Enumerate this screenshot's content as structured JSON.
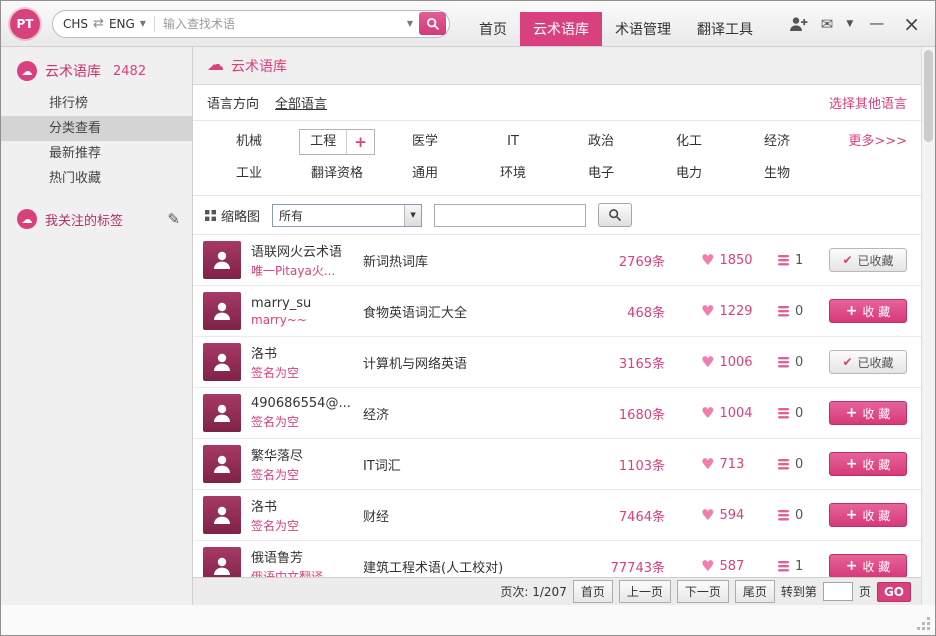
{
  "colors": {
    "accent": "#d8417d",
    "accent_dark": "#c02f67",
    "active_tab_bg": "#d8417d",
    "avatar_bg": "#8e2a55",
    "heart": "#f07fae",
    "sidebar_bg": "#f0f0f0"
  },
  "icons": {
    "swap": "⇄",
    "caret_down": "▼",
    "cloud": "☁",
    "pencil": "✎",
    "mail": "✉",
    "heart": "♥",
    "check": "✔",
    "plus": "+",
    "minimize": "—",
    "close": "×"
  },
  "topbar": {
    "logo": "PT",
    "search": {
      "lang_from": "CHS",
      "lang_to": "ENG",
      "placeholder": "输入查找术语"
    },
    "nav": [
      {
        "label": "首页"
      },
      {
        "label": "云术语库"
      },
      {
        "label": "术语管理"
      },
      {
        "label": "翻译工具"
      }
    ]
  },
  "sidebar": {
    "library_title": "云术语库",
    "library_count": "2482",
    "items": [
      {
        "label": "排行榜"
      },
      {
        "label": "分类查看"
      },
      {
        "label": "最新推荐"
      },
      {
        "label": "热门收藏"
      }
    ],
    "tags_title": "我关注的标签"
  },
  "main": {
    "header_title": "云术语库",
    "lang_row": {
      "label": "语言方向",
      "value": "全部语言",
      "other_link": "选择其他语言"
    },
    "categories_row1": [
      "机械",
      "工程",
      "医学",
      "IT",
      "政治",
      "化工",
      "经济"
    ],
    "categories_row2": [
      "工业",
      "翻译资格",
      "通用",
      "环境",
      "电子",
      "电力",
      "生物"
    ],
    "more_link": "更多>>>",
    "toolbar": {
      "view_label": "缩略图",
      "filter_value": "所有",
      "search_value": ""
    },
    "rows": [
      {
        "user": "语联网火云术语",
        "sub": "唯一Pitaya火...",
        "lib": "新词热词库",
        "count": "2769条",
        "likes": "1850",
        "stacks": "1",
        "collected": true,
        "btn_label": "已收藏"
      },
      {
        "user": "marry_su",
        "sub": "marry~~",
        "lib": "食物英语词汇大全",
        "count": "468条",
        "likes": "1229",
        "stacks": "0",
        "collected": false,
        "btn_label": "收 藏"
      },
      {
        "user": "洛书",
        "sub": "签名为空",
        "lib": "计算机与网络英语",
        "count": "3165条",
        "likes": "1006",
        "stacks": "0",
        "collected": true,
        "btn_label": "已收藏"
      },
      {
        "user": "490686554@...",
        "sub": "签名为空",
        "lib": "经济",
        "count": "1680条",
        "likes": "1004",
        "stacks": "0",
        "collected": false,
        "btn_label": "收 藏"
      },
      {
        "user": "繁华落尽",
        "sub": "签名为空",
        "lib": "IT词汇",
        "count": "1103条",
        "likes": "713",
        "stacks": "0",
        "collected": false,
        "btn_label": "收 藏"
      },
      {
        "user": "洛书",
        "sub": "签名为空",
        "lib": "财经",
        "count": "7464条",
        "likes": "594",
        "stacks": "0",
        "collected": false,
        "btn_label": "收 藏"
      },
      {
        "user": "俄语鲁芳",
        "sub": "俄语中文翻译",
        "lib": "建筑工程术语(人工校对)",
        "count": "77743条",
        "likes": "587",
        "stacks": "1",
        "collected": false,
        "btn_label": "收 藏"
      }
    ],
    "pagination": {
      "info": "页次: 1/207",
      "first": "首页",
      "prev": "上一页",
      "next": "下一页",
      "last": "尾页",
      "goto_label": "转到第",
      "goto_value": "",
      "page_label": "页",
      "go": "GO"
    }
  }
}
